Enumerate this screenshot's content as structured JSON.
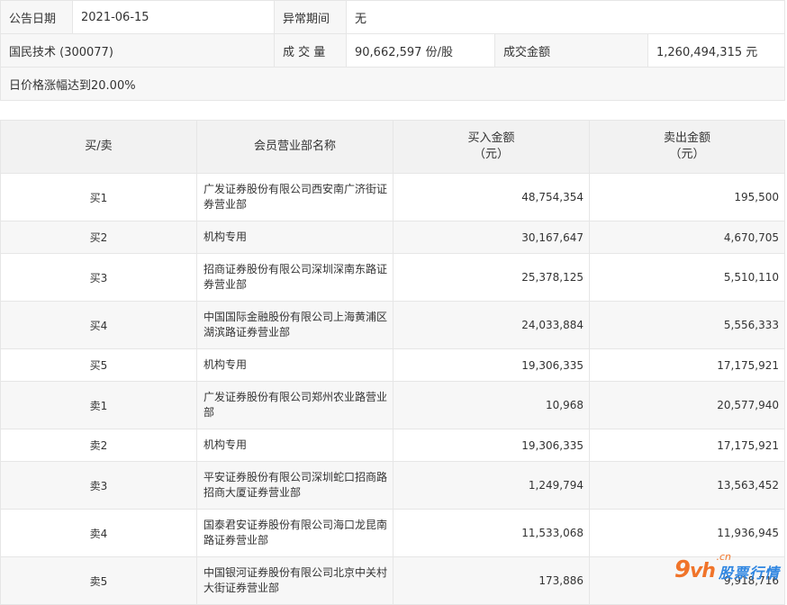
{
  "summary": {
    "announce_date_label": "公告日期",
    "announce_date_value": "2021-06-15",
    "abnormal_period_label": "异常期间",
    "abnormal_period_value": "无",
    "stock_name": "国民技术 (300077)",
    "volume_label": "成 交 量",
    "volume_value": "90,662,597 份/股",
    "turnover_label": "成交金额",
    "turnover_value": "1,260,494,315 元",
    "reason": "日价格涨幅达到20.00%"
  },
  "table": {
    "headers": {
      "side": "买/卖",
      "broker": "会员营业部名称",
      "buy_line1": "买入金额",
      "buy_line2": "（元）",
      "sell_line1": "卖出金额",
      "sell_line2": "（元）"
    },
    "rows": [
      {
        "side": "买1",
        "broker": "广发证券股份有限公司西安南广济街证券营业部",
        "buy": "48,754,354",
        "sell": "195,500"
      },
      {
        "side": "买2",
        "broker": "机构专用",
        "buy": "30,167,647",
        "sell": "4,670,705"
      },
      {
        "side": "买3",
        "broker": "招商证券股份有限公司深圳深南东路证券营业部",
        "buy": "25,378,125",
        "sell": "5,510,110"
      },
      {
        "side": "买4",
        "broker": "中国国际金融股份有限公司上海黄浦区湖滨路证券营业部",
        "buy": "24,033,884",
        "sell": "5,556,333"
      },
      {
        "side": "买5",
        "broker": "机构专用",
        "buy": "19,306,335",
        "sell": "17,175,921"
      },
      {
        "side": "卖1",
        "broker": "广发证券股份有限公司郑州农业路营业部",
        "buy": "10,968",
        "sell": "20,577,940"
      },
      {
        "side": "卖2",
        "broker": "机构专用",
        "buy": "19,306,335",
        "sell": "17,175,921"
      },
      {
        "side": "卖3",
        "broker": "平安证券股份有限公司深圳蛇口招商路招商大厦证券营业部",
        "buy": "1,249,794",
        "sell": "13,563,452"
      },
      {
        "side": "卖4",
        "broker": "国泰君安证券股份有限公司海口龙昆南路证券营业部",
        "buy": "11,533,068",
        "sell": "11,936,945"
      },
      {
        "side": "卖5",
        "broker": "中国银河证券股份有限公司北京中关村大街证券营业部",
        "buy": "173,886",
        "sell": "9,918,716"
      }
    ]
  },
  "watermark": {
    "logo_9": "9",
    "logo_vh": "vh",
    "logo_cn": ".cn",
    "text": "股票行情",
    "logo_color": "#f0742a",
    "text_color": "#2f86e1"
  }
}
